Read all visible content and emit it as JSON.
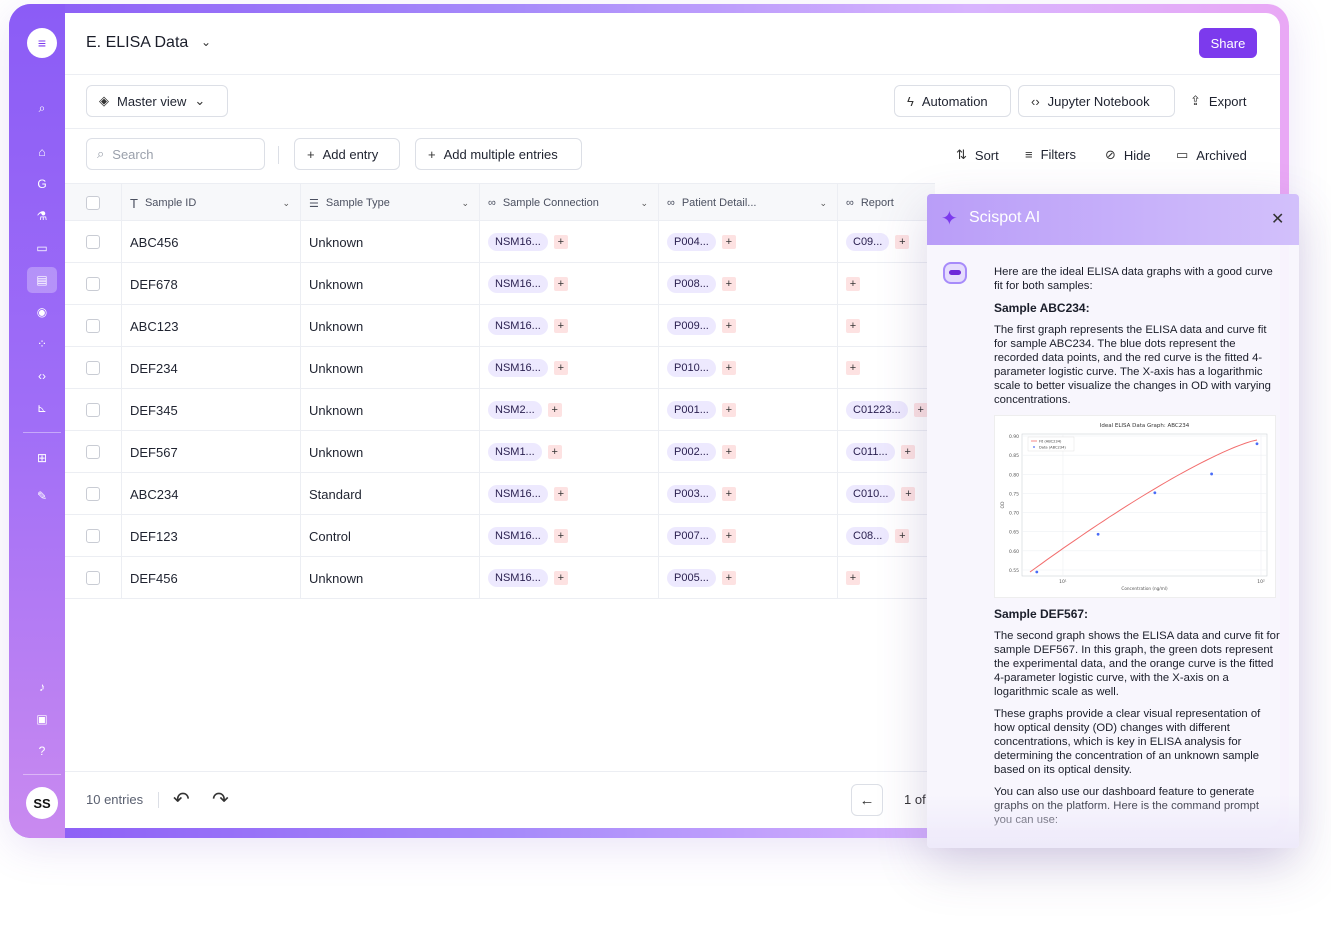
{
  "title": "E. ELISA Data",
  "share_label": "Share",
  "toolbar": {
    "view_label": "Master view",
    "automation_label": "Automation",
    "jupyter_label": "Jupyter  Notebook",
    "export_label": "Export"
  },
  "actions": {
    "search_placeholder": "Search",
    "add_entry_label": "Add entry",
    "add_multiple_label": "Add multiple entries",
    "sort_label": "Sort",
    "filters_label": "Filters",
    "hide_label": "Hide",
    "archived_label": "Archived"
  },
  "columns": [
    "Sample ID",
    "Sample Type",
    "Sample Connection",
    "Patient Detail...",
    "Report"
  ],
  "rows": [
    {
      "id": "ABC456",
      "type": "Unknown",
      "conn": "NSM16...",
      "patient": "P004...",
      "report": "C09..."
    },
    {
      "id": "DEF678",
      "type": "Unknown",
      "conn": "NSM16...",
      "patient": "P008...",
      "report": ""
    },
    {
      "id": "ABC123",
      "type": "Unknown",
      "conn": "NSM16...",
      "patient": "P009...",
      "report": ""
    },
    {
      "id": "DEF234",
      "type": "Unknown",
      "conn": "NSM16...",
      "patient": "P010...",
      "report": ""
    },
    {
      "id": "DEF345",
      "type": "Unknown",
      "conn": "NSM2...",
      "patient": "P001...",
      "report": "C01223..."
    },
    {
      "id": "DEF567",
      "type": "Unknown",
      "conn": "NSM1...",
      "patient": "P002...",
      "report": "C011..."
    },
    {
      "id": "ABC234",
      "type": "Standard",
      "conn": "NSM16...",
      "patient": "P003...",
      "report": "C010..."
    },
    {
      "id": "DEF123",
      "type": "Control",
      "conn": "NSM16...",
      "patient": "P007...",
      "report": "C08..."
    },
    {
      "id": "DEF456",
      "type": "Unknown",
      "conn": "NSM16...",
      "patient": "P005...",
      "report": ""
    }
  ],
  "footer": {
    "entries_label": "10 entries",
    "page_label": "1 of"
  },
  "sidebar": {
    "avatar_initials": "SS",
    "icons": [
      "search-icon",
      "home-icon",
      "google-icon",
      "flask-icon",
      "inbox-icon",
      "document-icon",
      "location-icon",
      "apps-icon",
      "code-icon",
      "chart-icon",
      "grid-icon",
      "pen-icon",
      "bell-icon",
      "chat-icon",
      "help-icon"
    ]
  },
  "ai": {
    "title": "Scispot AI",
    "intro": "Here are the ideal ELISA data graphs with a good curve fit for both samples:",
    "heading1": "Sample ABC234:",
    "para1": "The first graph represents the ELISA data and curve fit for sample ABC234. The blue dots represent the recorded data points, and the red curve is the fitted 4-parameter logistic curve. The X-axis has a logarithmic scale to better visualize the changes in OD with varying concentrations.",
    "heading2": "Sample DEF567:",
    "para2": "The second graph shows the ELISA data and curve fit for sample DEF567. In this graph, the green dots represent the experimental data, and the orange curve is the fitted 4-parameter logistic curve, with the X-axis on a logarithmic scale as well.",
    "para3": "These graphs provide a clear visual representation of how optical density (OD) changes with different concentrations, which is key in ELISA analysis for determining the concentration of an unknown sample based on its optical density.",
    "para4": "You can also use our dashboard feature to generate graphs on the platform. Here is the command prompt you can use:"
  },
  "mini_chart": {
    "title": "Ideal ELISA Data Graph: ABC234",
    "xlabel": "Concentration (ng/ml)",
    "ylabel": "OD",
    "legend": [
      "Fit (ABC234)",
      "Data (ABC234)"
    ],
    "yticks": [
      "0.90",
      "0.85",
      "0.80",
      "0.75",
      "0.70",
      "0.65",
      "0.60",
      "0.55"
    ],
    "xticks": [
      "10¹",
      "10²"
    ],
    "ylim": [
      0.55,
      0.9
    ],
    "points": [
      [
        0.03,
        0.55
      ],
      [
        0.3,
        0.65
      ],
      [
        0.55,
        0.76
      ],
      [
        0.8,
        0.81
      ],
      [
        1.0,
        0.89
      ]
    ],
    "fit_color": "#f26d6d",
    "data_color": "#4a6cf7"
  },
  "colors": {
    "accent": "#7c3aed",
    "chip_bg": "#ede9fe",
    "plus_bg": "#fde2e2"
  }
}
